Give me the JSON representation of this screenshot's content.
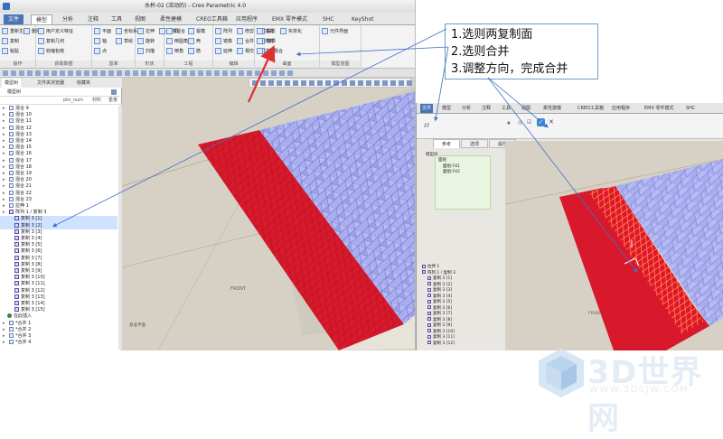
{
  "app": {
    "window_title": "水杯-02 (活动的) - Creo Parametric 4.0",
    "menu_tabs": [
      "文件",
      "模型",
      "分析",
      "注释",
      "工具",
      "视图",
      "柔性建模",
      "CREO工具箱",
      "应用程序",
      "EMX 零件模式",
      "SHC",
      "KeyShot"
    ],
    "active_tab": "模型"
  },
  "ribbon": {
    "groups": [
      {
        "label": "操作",
        "buttons": [
          "重新生成",
          "复制",
          "粘贴",
          "删除"
        ]
      },
      {
        "label": "获取数据",
        "buttons": [
          "用户定义特征",
          "复制几何",
          "收缩包络"
        ]
      },
      {
        "label": "基准",
        "buttons": [
          "平面",
          "轴",
          "点",
          "坐标系",
          "草绘"
        ]
      },
      {
        "label": "形状",
        "buttons": [
          "拉伸",
          "旋转",
          "扫描",
          "扫描混合"
        ]
      },
      {
        "label": "工程",
        "buttons": [
          "孔",
          "倒圆角",
          "倒角",
          "拔模",
          "壳",
          "筋"
        ]
      },
      {
        "label": "编辑",
        "buttons": [
          "阵列",
          "镜像",
          "延伸",
          "修剪",
          "合并",
          "相交",
          "投影",
          "偏移",
          "加厚",
          "实体化"
        ]
      },
      {
        "label": "曲面",
        "buttons": [
          "填充",
          "样式",
          "边界混合"
        ]
      },
      {
        "label": "模型意图",
        "buttons": [
          "元件界面"
        ]
      }
    ]
  },
  "nav_tabs": [
    "模型树",
    "文件夹浏览器",
    "收藏夹"
  ],
  "tree": {
    "header": "模型树",
    "columns": [
      "pto_num",
      "材料",
      "重量"
    ],
    "items": [
      {
        "label": "混合 9",
        "type": "feat"
      },
      {
        "label": "混合 10",
        "type": "feat"
      },
      {
        "label": "混合 11",
        "type": "feat"
      },
      {
        "label": "混合 12",
        "type": "feat"
      },
      {
        "label": "混合 13",
        "type": "feat"
      },
      {
        "label": "混合 14",
        "type": "feat"
      },
      {
        "label": "混合 15",
        "type": "feat"
      },
      {
        "label": "混合 16",
        "type": "feat"
      },
      {
        "label": "混合 17",
        "type": "feat"
      },
      {
        "label": "混合 18",
        "type": "feat"
      },
      {
        "label": "混合 19",
        "type": "feat"
      },
      {
        "label": "混合 20",
        "type": "feat"
      },
      {
        "label": "混合 21",
        "type": "feat"
      },
      {
        "label": "混合 22",
        "type": "feat"
      },
      {
        "label": "混合 23",
        "type": "feat"
      },
      {
        "label": "拉伸 1",
        "type": "feat"
      },
      {
        "label": "阵列 1 / 复制 3",
        "type": "ptn"
      },
      {
        "label": "复制 3 [1]",
        "type": "ptn",
        "sel": true
      },
      {
        "label": "复制 3 [2]",
        "type": "ptn",
        "sel": true
      },
      {
        "label": "复制 3 [3]",
        "type": "ptn"
      },
      {
        "label": "复制 3 [4]",
        "type": "ptn"
      },
      {
        "label": "复制 3 [5]",
        "type": "ptn"
      },
      {
        "label": "复制 3 [6]",
        "type": "ptn"
      },
      {
        "label": "复制 3 [7]",
        "type": "ptn"
      },
      {
        "label": "复制 3 [8]",
        "type": "ptn"
      },
      {
        "label": "复制 3 [9]",
        "type": "ptn"
      },
      {
        "label": "复制 3 [10]",
        "type": "ptn"
      },
      {
        "label": "复制 3 [11]",
        "type": "ptn"
      },
      {
        "label": "复制 3 [12]",
        "type": "ptn"
      },
      {
        "label": "复制 3 [13]",
        "type": "ptn"
      },
      {
        "label": "复制 3 [14]",
        "type": "ptn"
      },
      {
        "label": "复制 3 [15]",
        "type": "ptn"
      },
      {
        "label": "在此插入",
        "type": "ins"
      },
      {
        "label": "*合并 1",
        "type": "feat"
      },
      {
        "label": "*合并 2",
        "type": "feat"
      },
      {
        "label": "*合并 3",
        "type": "feat"
      },
      {
        "label": "*合并 4",
        "type": "feat"
      }
    ]
  },
  "viewport1": {
    "label": "FRONT",
    "label2": "基准平面"
  },
  "shot2": {
    "menu_tabs": [
      "文件",
      "模型",
      "分析",
      "注释",
      "工具",
      "视图",
      "柔性建模",
      "CREO工具箱",
      "应用程序",
      "EMX 零件模式",
      "SHC"
    ],
    "subtabs": [
      "参考",
      "选项",
      "属性"
    ],
    "ref_title": "面组",
    "ref_items": [
      "面组:F41",
      "面组:F42"
    ],
    "tree_header": "模型树",
    "label": "FRONT",
    "tree_items": [
      "拉伸 1",
      "阵列 1 / 复制 3",
      "复制 3 [1]",
      "复制 3 [2]",
      "复制 3 [3]",
      "复制 3 [4]",
      "复制 3 [5]",
      "复制 3 [6]",
      "复制 3 [7]",
      "复制 3 [8]",
      "复制 3 [9]",
      "复制 3 [10]",
      "复制 3 [11]",
      "复制 3 [12]"
    ]
  },
  "annotation": {
    "steps": [
      "1.选则两复制面",
      "2.选则合并",
      "3.调整方向，完成合并"
    ],
    "color": "#3f6fc7"
  },
  "watermark": {
    "title": "3D世界网",
    "url": "WWW.3DSJW.COM"
  },
  "colors": {
    "red_surface": "#d8192c",
    "blue_surface": "#a8aee8",
    "arrow_red": "#e03030",
    "arrow_blue": "#3f6fc7"
  }
}
